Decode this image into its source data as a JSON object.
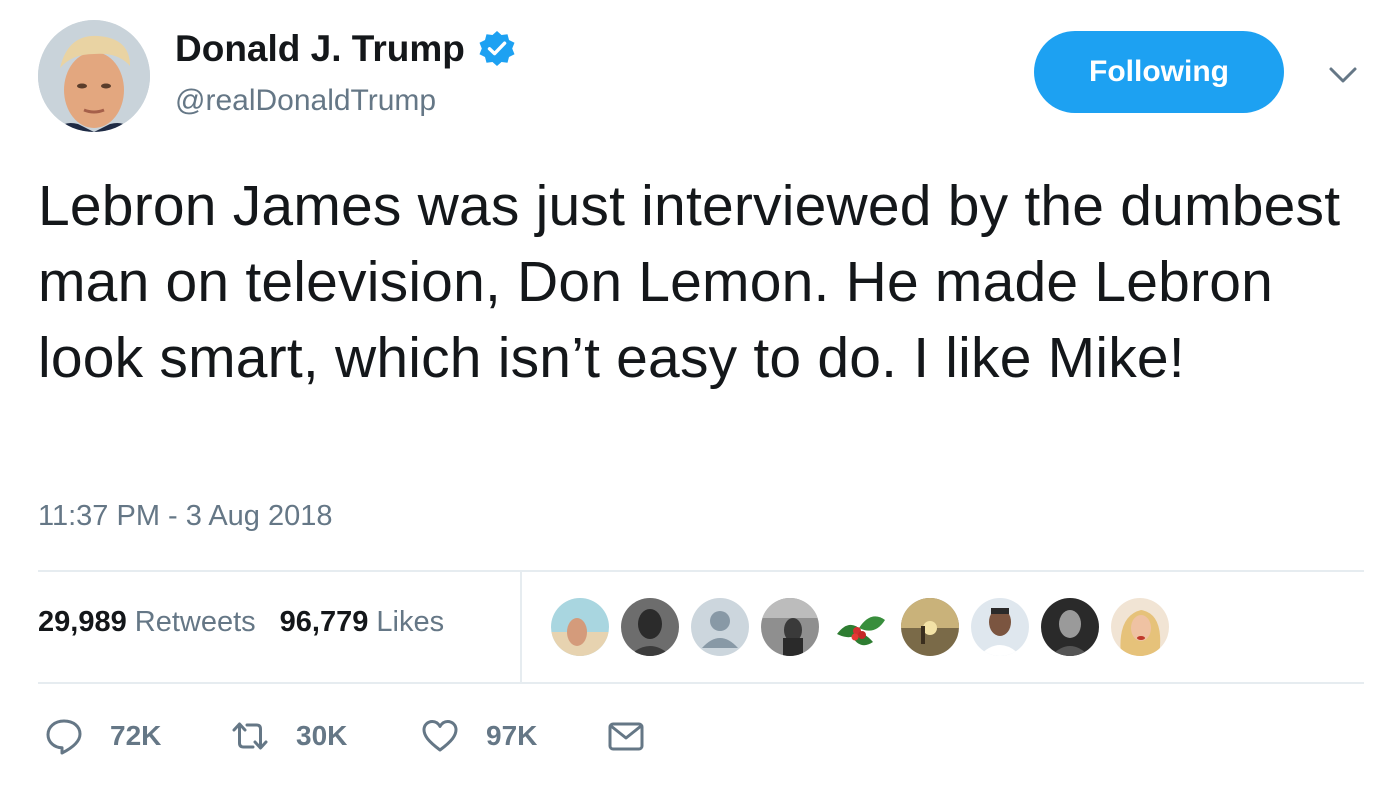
{
  "author": {
    "display_name": "Donald J. Trump",
    "handle": "@realDonaldTrump",
    "verified_color": "#1da1f2"
  },
  "follow_button": {
    "label": "Following",
    "color": "#1da1f2"
  },
  "tweet": {
    "text": "Lebron James was just interviewed by the dumbest man on television, Don Lemon. He made Lebron look smart, which isn’t easy to do. I like Mike!",
    "timestamp": "11:37 PM - 3 Aug 2018"
  },
  "stats": {
    "retweets_count": "29,989",
    "retweets_label": "Retweets",
    "likes_count": "96,779",
    "likes_label": "Likes"
  },
  "likers": [
    "avatar",
    "avatar",
    "default-avatar",
    "avatar",
    "holly-avatar",
    "avatar",
    "avatar",
    "avatar",
    "avatar"
  ],
  "actions": {
    "reply_count": "72K",
    "retweet_count": "30K",
    "like_count": "97K"
  },
  "colors": {
    "secondary_text": "#657786",
    "primary_text": "#14171a",
    "divider": "#e6ecf0"
  }
}
